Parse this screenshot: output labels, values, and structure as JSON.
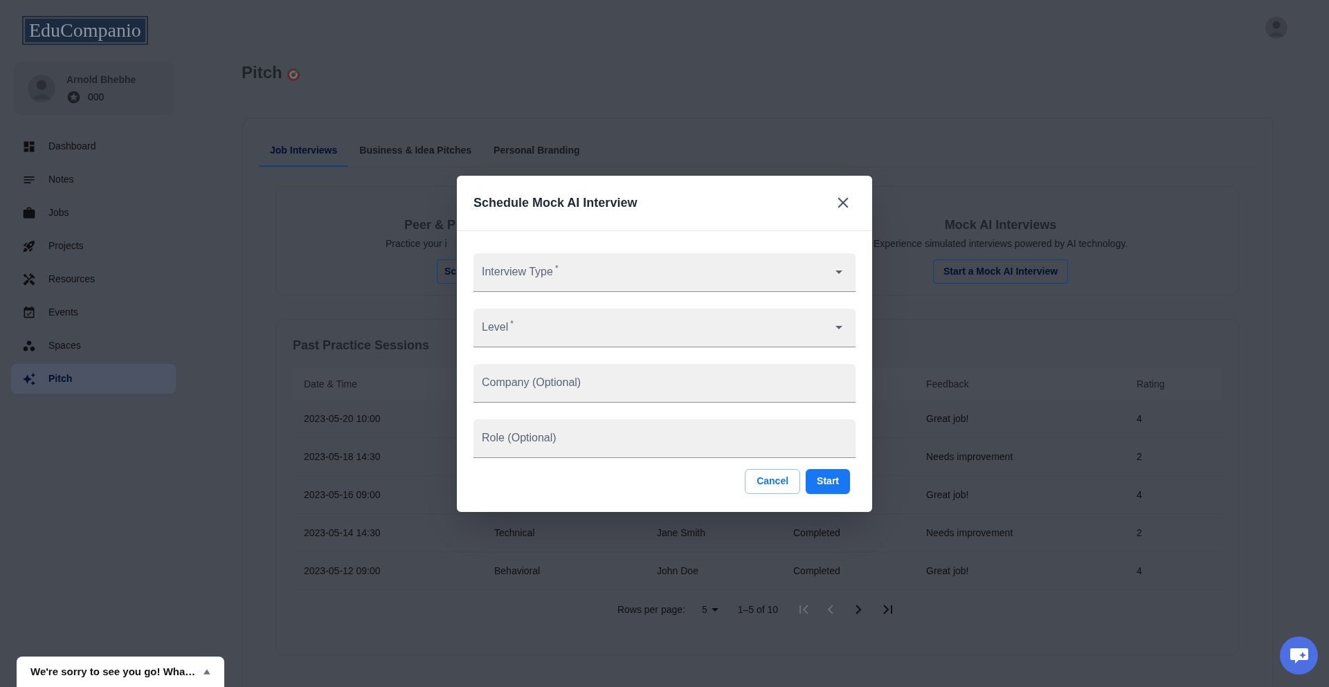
{
  "logo": "EduCompanio",
  "profile": {
    "name": "Arnold Bhebhe",
    "points": "000"
  },
  "nav": [
    {
      "label": "Dashboard",
      "selected": false
    },
    {
      "label": "Notes",
      "selected": false
    },
    {
      "label": "Jobs",
      "selected": false
    },
    {
      "label": "Projects",
      "selected": false
    },
    {
      "label": "Resources",
      "selected": false
    },
    {
      "label": "Events",
      "selected": false
    },
    {
      "label": "Spaces",
      "selected": false
    },
    {
      "label": "Pitch",
      "selected": true
    }
  ],
  "page_title": "Pitch",
  "tabs": [
    {
      "label": "Job Interviews",
      "selected": true
    },
    {
      "label": "Business & Idea Pitches",
      "selected": false
    },
    {
      "label": "Personal Branding",
      "selected": false
    }
  ],
  "cards": [
    {
      "title": "Peer & P",
      "description": "Practice your i",
      "button": "Sc"
    },
    {
      "title": "Mock AI Interviews",
      "description": "Experience simulated interviews powered by AI technology.",
      "button": "Start a Mock AI Interview"
    }
  ],
  "sessions": {
    "title": "Past Practice Sessions",
    "columns": [
      "Date & Time",
      null,
      null,
      null,
      "Feedback",
      "Rating"
    ],
    "rows": [
      [
        "2023-05-20 10:00",
        null,
        null,
        null,
        "Great job!",
        "4"
      ],
      [
        "2023-05-18 14:30",
        null,
        null,
        null,
        "Needs improvement",
        "2"
      ],
      [
        "2023-05-16 09:00",
        null,
        null,
        null,
        "Great job!",
        "4"
      ],
      [
        "2023-05-14 14:30",
        "Technical",
        "Jane Smith",
        "Completed",
        "Needs improvement",
        "2"
      ],
      [
        "2023-05-12 09:00",
        "Behavioral",
        "John Doe",
        "Completed",
        "Great job!",
        "4"
      ]
    ]
  },
  "pagination": {
    "rows_per_page_label": "Rows per page:",
    "rows_per_page": "5",
    "range": "1–5 of 10",
    "buttons": [
      {
        "kind": "first",
        "disabled": true
      },
      {
        "kind": "previous",
        "disabled": true
      },
      {
        "kind": "next",
        "disabled": false
      },
      {
        "kind": "last",
        "disabled": false
      }
    ]
  },
  "dialog": {
    "title": "Schedule Mock AI Interview",
    "fields": [
      {
        "label": "Interview Type",
        "mark": "*",
        "kind": "select"
      },
      {
        "label": "Level",
        "mark": "*",
        "kind": "select"
      },
      {
        "label": "Company (Optional)",
        "kind": "text"
      },
      {
        "label": "Role (Optional)",
        "kind": "text"
      }
    ],
    "buttons": [
      {
        "label": "Cancel",
        "kind": "outlined"
      },
      {
        "label": "Start",
        "kind": "contained"
      }
    ]
  },
  "feedback_widget": {
    "text": "We're sorry to see you go! Wha…"
  }
}
